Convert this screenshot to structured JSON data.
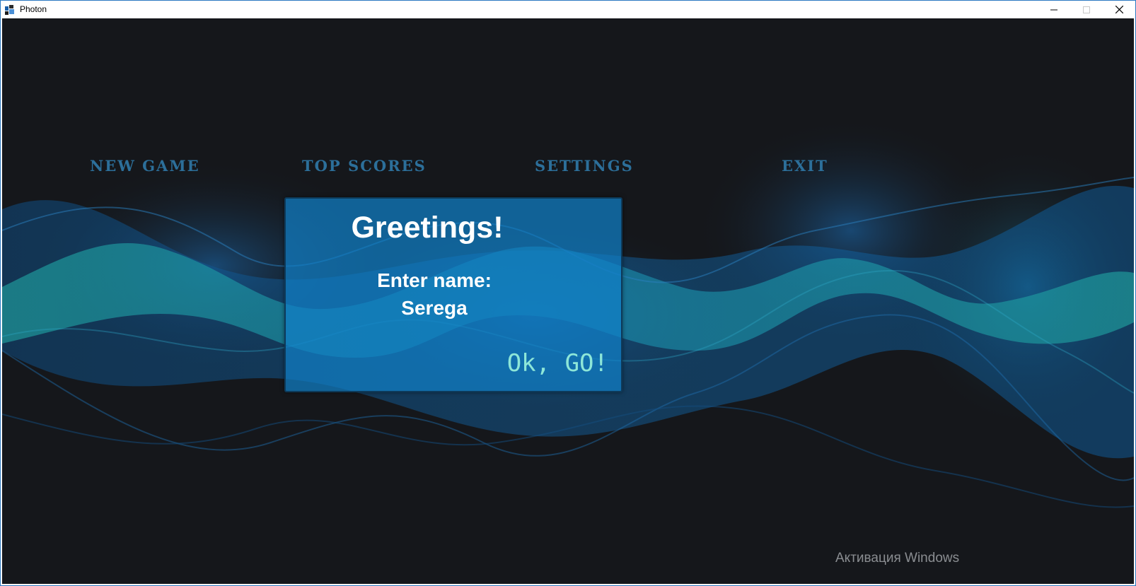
{
  "window": {
    "title": "Photon",
    "icon": "photon-app-icon",
    "controls": [
      "minimize-icon",
      "maximize-icon",
      "close-icon"
    ]
  },
  "menu": {
    "items": [
      {
        "label": "NEW GAME"
      },
      {
        "label": "TOP SCORES"
      },
      {
        "label": "SETTINGS"
      },
      {
        "label": "EXIT"
      }
    ],
    "color": "#2c6f9a"
  },
  "dialog": {
    "title": "Greetings!",
    "prompt": "Enter name:",
    "name_value": "Serega",
    "ok_button": "Ok, GO!",
    "background": "#1080c8",
    "ok_color": "#8de6d8"
  },
  "watermark": {
    "text": "Активация Windows"
  },
  "colors": {
    "background": "#15171b",
    "wave_teal": "#1f9c9c",
    "wave_blue": "#1266a8"
  }
}
